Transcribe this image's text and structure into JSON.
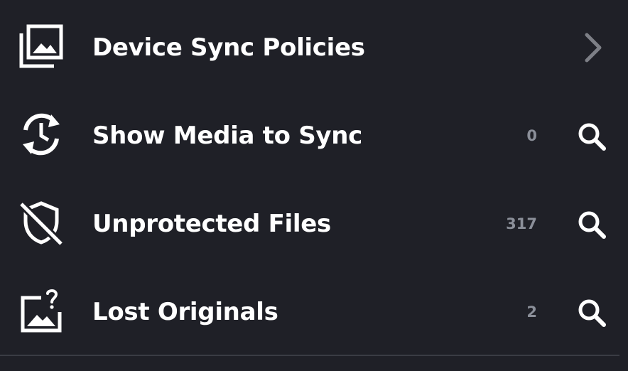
{
  "theme": {
    "background": "#1f2027",
    "text": "#ffffff",
    "muted": "#8b8f99",
    "chevron": "#7d7f86",
    "divider": "#3a3c44"
  },
  "menu": {
    "items": [
      {
        "label": "Device Sync Policies",
        "icon": "photo-library-icon",
        "action": "chevron-right-icon"
      },
      {
        "label": "Show Media to Sync",
        "icon": "sync-clock-icon",
        "count": "0",
        "action": "search-icon"
      },
      {
        "label": "Unprotected Files",
        "icon": "shield-off-icon",
        "count": "317",
        "action": "search-icon"
      },
      {
        "label": "Lost Originals",
        "icon": "image-question-icon",
        "count": "2",
        "action": "search-icon"
      }
    ]
  }
}
